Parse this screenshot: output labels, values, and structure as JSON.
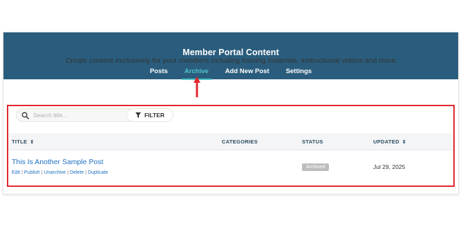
{
  "header": {
    "title": "Member Portal Content",
    "tabs": [
      {
        "label": "Posts",
        "active": false
      },
      {
        "label": "Archive",
        "active": true
      },
      {
        "label": "Add New Post",
        "active": false
      },
      {
        "label": "Settings",
        "active": false
      }
    ]
  },
  "intro": "Create content exclusively for your members including training materials, instructional videos and more.",
  "search": {
    "placeholder": "Search title...",
    "value": ""
  },
  "filter": {
    "label": "FILTER"
  },
  "table": {
    "columns": [
      "TITLE",
      "CATEGORIES",
      "STATUS",
      "UPDATED"
    ],
    "rows": [
      {
        "title": "This Is Another Sample Post",
        "actions": [
          "Edit",
          "Publish",
          "Unarchive",
          "Delete",
          "Duplicate"
        ],
        "categories": "",
        "status": "Archived",
        "updated": "Jul 29, 2025"
      }
    ]
  },
  "colors": {
    "header_bg": "#2a5d7d",
    "active_tab": "#4fc4c8",
    "link": "#1e6fc3",
    "annotation_red": "#e2262d",
    "badge_bg": "#bdbdbd"
  },
  "icons": {
    "search": "magnifier-icon",
    "filter": "funnel-icon",
    "sort": "sort-arrows-icon",
    "annotation_arrow": "red-up-arrow-icon"
  }
}
